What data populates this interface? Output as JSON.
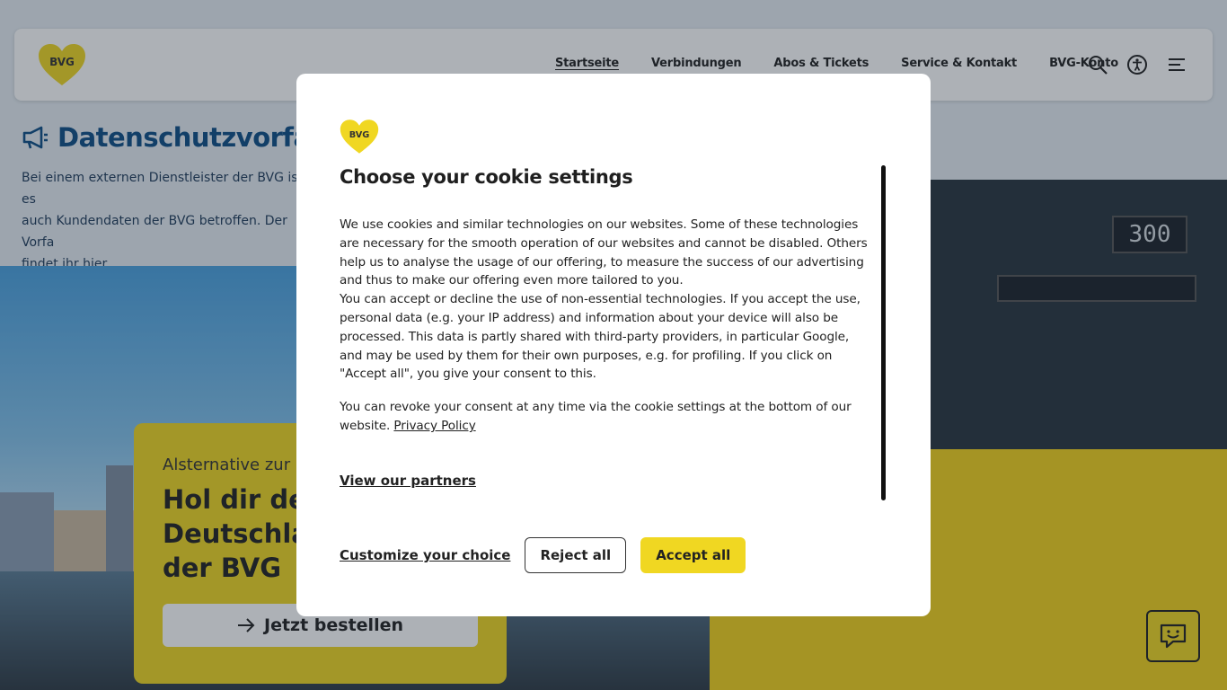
{
  "header": {
    "logo_text": "BVG",
    "nav": [
      {
        "label": "Startseite",
        "active": true
      },
      {
        "label": "Verbindungen",
        "active": false
      },
      {
        "label": "Abos & Tickets",
        "active": false
      },
      {
        "label": "Service & Kontakt",
        "active": false
      },
      {
        "label": "BVG-Konto",
        "active": false
      }
    ],
    "icons": [
      "search-icon",
      "accessibility-icon",
      "menu-icon"
    ]
  },
  "notice": {
    "title": "Datenschutzvorfall",
    "line1": "Bei einem externen Dienstleister der BVG ist es",
    "line2": "auch Kundendaten der BVG betroffen. Der Vorfa",
    "link": "findet ihr hier",
    "link_suffix": "."
  },
  "hero": {
    "bus_number": "300"
  },
  "promo": {
    "kicker": "Alsternative zur Sp",
    "title_line1": "Hol dir dein",
    "title_line2": "Deutschlan",
    "title_line3": "der BVG",
    "button_label": "Jetzt bestellen"
  },
  "cookie_dialog": {
    "logo_text": "BVG",
    "title": "Choose your cookie settings",
    "paragraph1": "We use cookies and similar technologies on our websites. Some of these technologies are necessary for the smooth operation of our websites and cannot be disabled. Others help us to analyse the usage of our offering, to measure the success of our advertising and thus to make our offering even more tailored to you.",
    "paragraph2": "You can accept or decline the use of non-essential technologies. If you accept the use, personal data (e.g. your IP address) and information about your device will also be processed. This data is partly shared with third-party providers, in particular Google, and may be used by them for their own purposes, e.g. for profiling. If you click on \"Accept all\", you give your consent to this.",
    "paragraph3": "You can revoke your consent at any time via the cookie settings at the bottom of our website.",
    "privacy_link": "Privacy Policy",
    "partners_link": "View our partners",
    "customize_label": "Customize your choice",
    "reject_label": "Reject all",
    "accept_label": "Accept all"
  },
  "colors": {
    "brand_yellow": "#f0d722",
    "notice_blue": "#0d4e86"
  }
}
